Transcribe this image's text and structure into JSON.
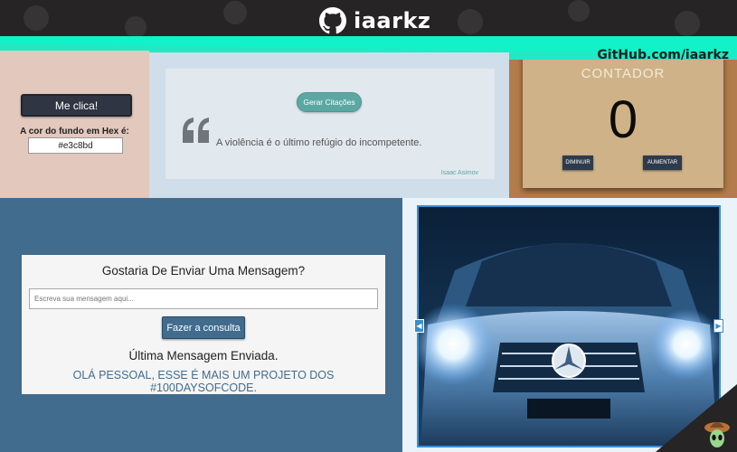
{
  "header": {
    "brand": "iaarkz",
    "github_link": "GitHub.com/iaarkz"
  },
  "color_panel": {
    "button_label": "Me clica!",
    "hex_label": "A cor do fundo em Hex é:",
    "hex_value": "#e3c8bd",
    "background": "#e3c8bd"
  },
  "quote_panel": {
    "button_label": "Gerar Citações",
    "quote": "A violência é o último refúgio do incompetente.",
    "author": "Isaac Asimov",
    "accent": "#5ba8a3"
  },
  "counter_panel": {
    "title": "CONTADOR",
    "value": "0",
    "decrease_label": "DIMINUIR",
    "increase_label": "AUMENTAR"
  },
  "message_panel": {
    "title": "Gostaria De Enviar Uma Mensagem?",
    "input_placeholder": "Escreva sua mensagem aqui...",
    "submit_label": "Fazer a consulta",
    "last_label": "Última Mensagem Enviada.",
    "last_message": "OLÁ PESSOAL, ESSE É MAIS UM PROJETO DOS #100DAYSOFCODE.",
    "accent": "#416c8e"
  },
  "carousel_panel": {
    "image_subject": "car",
    "prev_icon": "chevron-left-icon",
    "next_icon": "chevron-right-icon"
  },
  "corner_badge": {
    "icon": "alien-icon"
  }
}
